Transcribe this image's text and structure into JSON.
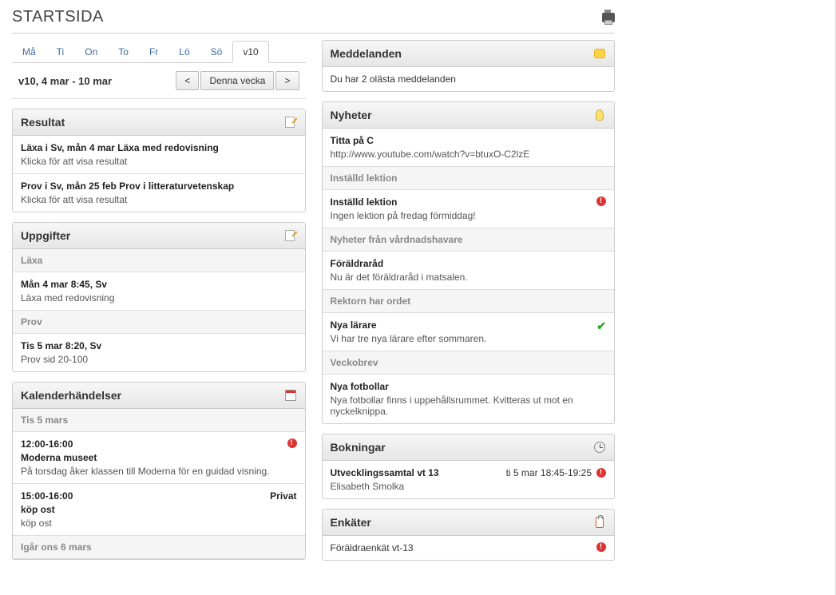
{
  "page_title": "STARTSIDA",
  "tabs": [
    "Må",
    "Ti",
    "On",
    "To",
    "Fr",
    "Lö",
    "Sö",
    "v10"
  ],
  "active_tab": 7,
  "week_label": "v10, 4 mar - 10 mar",
  "nav": {
    "prev": "<",
    "current": "Denna vecka",
    "next": ">"
  },
  "resultat": {
    "title": "Resultat",
    "items": [
      {
        "title": "Läxa i Sv, mån 4 mar Läxa med redovisning",
        "sub": "Klicka för att visa resultat"
      },
      {
        "title": "Prov i Sv, mån 25 feb Prov i litteraturvetenskap",
        "sub": "Klicka för att visa resultat"
      }
    ]
  },
  "uppgifter": {
    "title": "Uppgifter",
    "groups": [
      {
        "label": "Läxa",
        "items": [
          {
            "title": "Mån 4 mar 8:45, Sv",
            "sub": "Läxa med redovisning"
          }
        ]
      },
      {
        "label": "Prov",
        "items": [
          {
            "title": "Tis 5 mar 8:20, Sv",
            "sub": "Prov sid 20-100"
          }
        ]
      }
    ]
  },
  "kalender": {
    "title": "Kalenderhändelser",
    "days": [
      {
        "label": "Tis 5 mars",
        "events": [
          {
            "time": "12:00-16:00",
            "tag": "",
            "title": "Moderna museet",
            "desc": "På torsdag åker klassen till Moderna för en guidad visning.",
            "icon": "alert"
          },
          {
            "time": "15:00-16:00",
            "tag": "Privat",
            "title": "köp ost",
            "desc": "köp ost",
            "icon": ""
          }
        ]
      },
      {
        "label": "Igår ons 6 mars",
        "events": []
      }
    ]
  },
  "meddelanden": {
    "title": "Meddelanden",
    "text": "Du har 2 olästa meddelanden"
  },
  "nyheter": {
    "title": "Nyheter",
    "sections": [
      {
        "head": "",
        "items": [
          {
            "title": "Titta på C",
            "desc": "http://www.youtube.com/watch?v=btuxO-C2lzE",
            "icon": ""
          }
        ]
      },
      {
        "head": "Inställd lektion",
        "items": [
          {
            "title": "Inställd lektion",
            "desc": "Ingen lektion på fredag förmiddag!",
            "icon": "alert"
          }
        ]
      },
      {
        "head": "Nyheter från vårdnadshavare",
        "items": [
          {
            "title": "Föräldraråd",
            "desc": "Nu är det föräldraråd i matsalen.",
            "icon": ""
          }
        ]
      },
      {
        "head": "Rektorn har ordet",
        "items": [
          {
            "title": "Nya lärare",
            "desc": "Vi har tre nya lärare efter sommaren.",
            "icon": "check"
          }
        ]
      },
      {
        "head": "Veckobrev",
        "items": [
          {
            "title": "Nya fotbollar",
            "desc": "Nya fotbollar finns i uppehållsrummet. Kvitteras ut mot en nyckelknippa.",
            "icon": ""
          }
        ]
      }
    ]
  },
  "bokningar": {
    "title": "Bokningar",
    "items": [
      {
        "title": "Utvecklingssamtal vt 13",
        "sub": "Elisabeth Smolka",
        "time": "ti 5 mar 18:45-19:25",
        "icon": "alert"
      }
    ]
  },
  "enkater": {
    "title": "Enkäter",
    "items": [
      {
        "title": "Föräldraenkät vt-13",
        "icon": "alert"
      }
    ]
  }
}
